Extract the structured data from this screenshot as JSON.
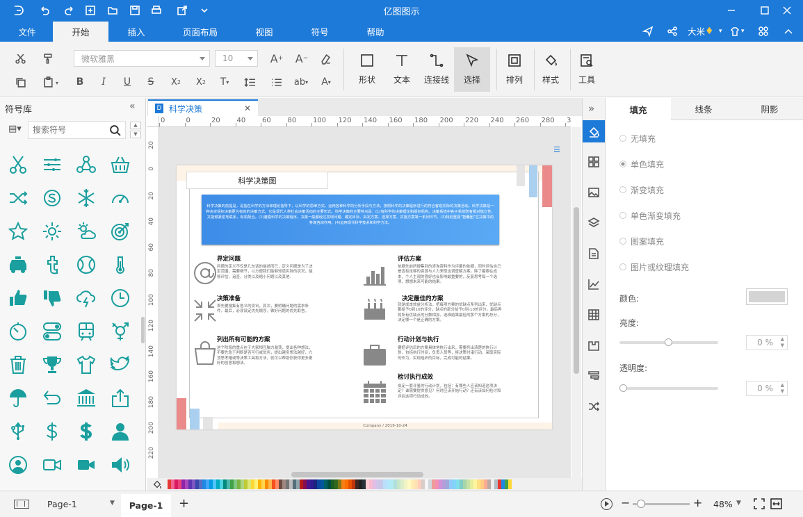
{
  "app": {
    "title": "亿图图示"
  },
  "menu": [
    "文件",
    "开始",
    "插入",
    "页面布局",
    "视图",
    "符号",
    "帮助"
  ],
  "user": {
    "name": "大米"
  },
  "ribbon": {
    "font_name": "微软雅黑",
    "font_size": "10",
    "shape_label": "形状",
    "text_label": "文本",
    "connector_label": "连接线",
    "select_label": "选择",
    "arrange_label": "排列",
    "style_label": "样式",
    "tools_label": "工具"
  },
  "library": {
    "title": "符号库",
    "search_placeholder": "搜索符号"
  },
  "doc": {
    "tab_name": "科学决策",
    "ruler_ticks": [
      "0",
      "0",
      "20",
      "40",
      "60",
      "80",
      "100",
      "120",
      "140",
      "160",
      "180",
      "200",
      "220",
      "240",
      "260",
      "280",
      "300"
    ],
    "vruler_ticks": [
      "20",
      "0",
      "20",
      "40",
      "60",
      "80",
      "100",
      "120",
      "140",
      "160",
      "180",
      "200",
      "220"
    ],
    "title": "科学决策图",
    "intro": "科学决策的前提是，是指在科学的方法和理论指导下，以科学的思维方式，运用各种科学的分析手段与方法，按照科学的决策程序进行的符合客观实际的决策活动。科学决策是一种决定组织决策更为有效的决策方式。它是现代人类社会决策活动的主要形式。科学决策的主要特点是：(1)有科学的决策理论和组织机构。决策系统中各子系统既有相对独立性，又能够紧密地联系，有机配合。(2)遵循科学的决策程序。决策一般都经过发现问题、确定目标、拟定方案、选择方案、实施方案等一系列环节。(3)特别重视“智囊团”在决策中的参谋咨询作用。(4)运用现代科学技术和科学方法。",
    "sections": [
      {
        "title": "界定问题",
        "text": "问题的定义不仅是几句话的描述而已，定义问题是为了决定范围，需要细节，以方便我们能够知道实际的状况，能够评估，追查，分类以及缩小问题以及其他."
      },
      {
        "title": "决策准备",
        "text": "首先要搜集有意义的资讯，其次，要明确问题的需求条件，最后，必须设定优先顺序，做好问题的优先取舍。"
      },
      {
        "title": "列出所有可能的方案",
        "text": "这个阶段的重点在于大家相互脑力激荡，提出各种想法，不要先急于判断是否可行或优劣，提出越多想法越好，六顶思考帽或等决策工具和方法，就可以帮助你获得更多更好的创意和想法。"
      },
      {
        "title": "评估方案",
        "text": "依据先前所搜集到的咨询资料作为评量的依据，同时评估自己是否有足够的资源与人力来取这调查解方案。除了着眼在成本，个人主观的喜好也会影响最重要的，反复思考每一个选项，想想未来可能的结果。"
      },
      {
        "title": "决定最佳的方案",
        "text": "就是成本效益分析法，把每项方案的优缺点条列出来，优缺点都给予0到10的评分，缺点的部分给予0到-10的评分，最后再将所有优缺点的分数相加，选择结果最佳的那个方案的总分，决定哪一个是正确的方案。"
      },
      {
        "title": "行动计划与执行",
        "text": "要把评估后的方案具体地执行出来，需要列出清楚的执行计划，包括执行时间，负责人员等，将决策付诸行动，采取实际的作为，实现组织的目标，完成可能的结果。"
      },
      {
        "title": "检讨执行成效",
        "text": "拟定一套评鉴的行动计划，包括：有哪些人应该知道这项决定？谁需要提供意见？何时应该开始行动？还有该如何检讨和评估这项行动成效。"
      }
    ],
    "footer": "Company / 2019-10-24"
  },
  "right_panel": {
    "tabs": [
      "填充",
      "线条",
      "阴影"
    ],
    "options": [
      "无填充",
      "单色填充",
      "渐变填充",
      "单色渐变填充",
      "图案填充",
      "图片或纹理填充"
    ],
    "color_label": "颜色:",
    "brightness_label": "亮度:",
    "brightness_value": "0 %",
    "transparency_label": "透明度:",
    "transparency_value": "0 %"
  },
  "status": {
    "page_select": "Page-1",
    "page_tab": "Page-1",
    "zoom": "48%"
  },
  "colors": {
    "accent": "#1e7ad8",
    "icon_teal": "#1a9e9e",
    "palette": [
      "#e53935",
      "#f06292",
      "#d81b60",
      "#ec407a",
      "#8e24aa",
      "#ab47bc",
      "#5e35b1",
      "#7e57c2",
      "#3949ab",
      "#5c6bc0",
      "#1e88e5",
      "#42a5f5",
      "#039be5",
      "#4fc3f7",
      "#00acc1",
      "#4dd0e1",
      "#00897b",
      "#4db6ac",
      "#43a047",
      "#81c784",
      "#7cb342",
      "#aed581",
      "#c0ca33",
      "#dce775",
      "#fdd835",
      "#fff176",
      "#ffb300",
      "#ffd54f",
      "#fb8c00",
      "#ffb74d",
      "#f4511e",
      "#ff8a65",
      "#6d4c41",
      "#a1887f",
      "#757575",
      "#bdbdbd",
      "#546e7a",
      "#90a4ae",
      "#b71c1c",
      "#880e4f",
      "#4a148c",
      "#311b92",
      "#1a237e",
      "#0d47a1",
      "#01579b",
      "#006064",
      "#004d40",
      "#1b5e20",
      "#33691e",
      "#827717",
      "#f57f17",
      "#ff6f00",
      "#e65100",
      "#bf360c",
      "#3e2723",
      "#212121",
      "#263238",
      "#ffcdd2",
      "#f8bbd0",
      "#e1bee7",
      "#d1c4e9",
      "#c5cae9",
      "#bbdefb",
      "#b3e5fc",
      "#b2ebf2",
      "#b2dfdb",
      "#c8e6c9",
      "#dcedc8",
      "#f0f4c3",
      "#fff9c4",
      "#ffecb3",
      "#ffe0b2",
      "#ffccbc",
      "#d7ccc8",
      "#f5f5f5",
      "#cfd8dc",
      "#ef9a9a",
      "#f48fb1",
      "#ce93d8",
      "#b39ddb",
      "#9fa8da",
      "#90caf9",
      "#81d4fa",
      "#80deea",
      "#80cbc4",
      "#a5d6a7",
      "#c5e1a5",
      "#e6ee9c",
      "#fff59d",
      "#ffe082",
      "#ffcc80",
      "#ffab91",
      "#bcaaa4",
      "#eeeeee",
      "#b0bec5",
      "#e53935",
      "#1e88e5",
      "#43a047",
      "#fdd835"
    ]
  }
}
